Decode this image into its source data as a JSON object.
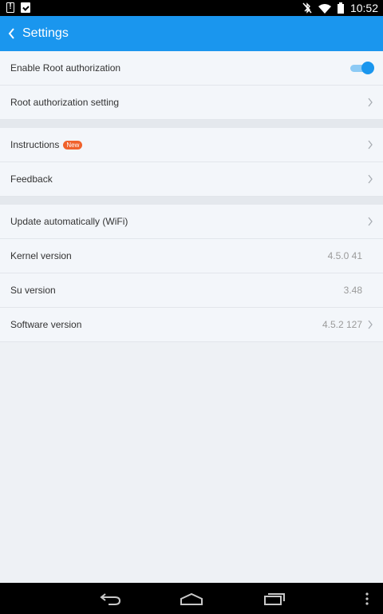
{
  "status_bar": {
    "time": "10:52",
    "left_icons": [
      "alert-notification-icon",
      "clipboard-check-icon"
    ],
    "right_icons": [
      "bluetooth-off-icon",
      "wifi-icon",
      "battery-icon"
    ]
  },
  "app_bar": {
    "title": "Settings",
    "back_icon": "chevron-left-icon",
    "color": "#1a96ee"
  },
  "sections": [
    {
      "rows": [
        {
          "label": "Enable Root authorization",
          "control": "toggle",
          "toggle_on": true
        },
        {
          "label": "Root authorization setting",
          "control": "chevron"
        }
      ]
    },
    {
      "rows": [
        {
          "label": "Instructions",
          "badge": "New",
          "control": "chevron"
        },
        {
          "label": "Feedback",
          "control": "chevron"
        }
      ]
    },
    {
      "rows": [
        {
          "label": "Update automatically (WiFi)",
          "control": "chevron"
        },
        {
          "label": "Kernel version",
          "value": "4.5.0 41"
        },
        {
          "label": "Su version",
          "value": "3.48"
        },
        {
          "label": "Software version",
          "value": "4.5.2 127",
          "control": "chevron"
        }
      ]
    }
  ],
  "nav_bar": {
    "buttons": [
      "back-icon",
      "home-icon",
      "recents-icon",
      "menu-dots-icon"
    ]
  },
  "colors": {
    "accent": "#1a96ee",
    "badge": "#f0622c"
  }
}
